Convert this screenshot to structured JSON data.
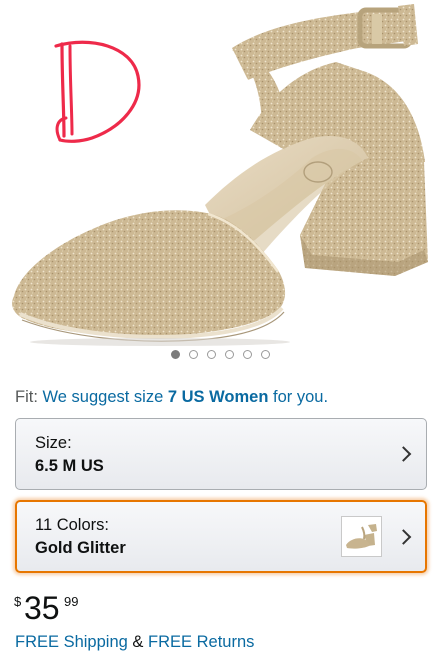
{
  "product_image": {
    "annotation_letter": "D",
    "gallery": {
      "count": 6,
      "active_index": 0
    }
  },
  "fit": {
    "prefix": "Fit:",
    "suggest_text": "We suggest size",
    "suggested_size": "7 US Women",
    "suffix": "for you."
  },
  "size_selector": {
    "label": "Size:",
    "value": "6.5 M US"
  },
  "color_selector": {
    "label": "11 Colors:",
    "value": "Gold Glitter"
  },
  "price": {
    "currency": "$",
    "whole": "35",
    "fraction": "99"
  },
  "shipping": {
    "free_shipping": "FREE Shipping",
    "ampersand": "&",
    "free_returns": "FREE Returns"
  },
  "colors": {
    "link": "#0a6aa1",
    "selected_border": "#e77600",
    "annotation_red": "#ee2a4a",
    "shoe_gold": "#c7b38f"
  },
  "icons": {
    "selector_arrow": "chevron-right-icon"
  }
}
